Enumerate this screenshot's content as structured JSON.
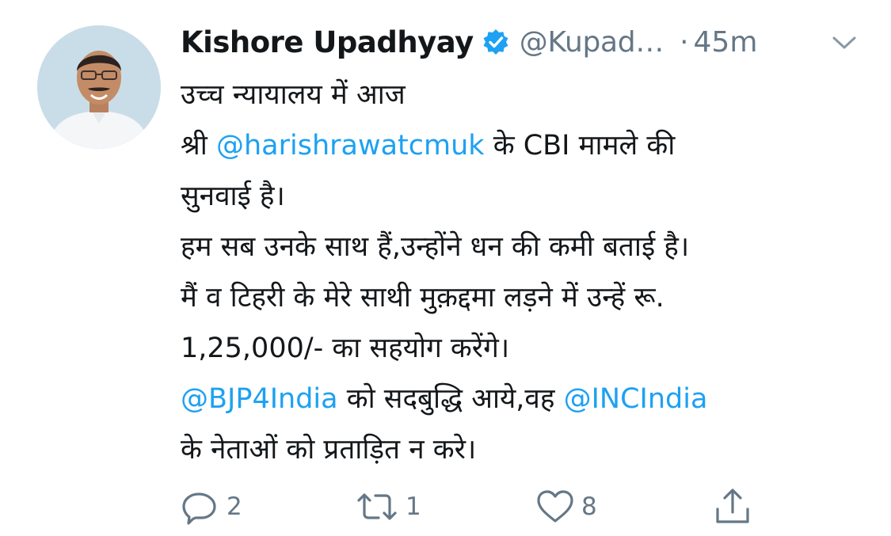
{
  "tweet": {
    "author": {
      "name": "Kishore Upadhyay",
      "handle": "@Kupad…",
      "verified": true,
      "avatar": "person-avatar"
    },
    "separator": "·",
    "time": "45m",
    "menu_icon": "chevron-down-icon",
    "lines": [
      [
        {
          "text": "उच्च न्यायालय में आज",
          "mention": false
        }
      ],
      [
        {
          "text": "श्री ",
          "mention": false
        },
        {
          "text": "@harishrawatcmuk",
          "mention": true
        },
        {
          "text": " के CBI मामले की",
          "mention": false
        }
      ],
      [
        {
          "text": "सुनवाई है।",
          "mention": false
        }
      ],
      [
        {
          "text": "हम सब उनके साथ हैं,उन्होंने धन की कमी बताई है।",
          "mention": false
        }
      ],
      [
        {
          "text": "मैं व टिहरी के मेरे साथी मुक़द्दमा लड़ने में उन्हें रू.",
          "mention": false
        }
      ],
      [
        {
          "text": "1,25,000/- का सहयोग करेंगे।",
          "mention": false
        }
      ],
      [
        {
          "text": "@BJP4India",
          "mention": true
        },
        {
          "text": " को सदबुद्धि आये,वह ",
          "mention": false
        },
        {
          "text": "@INCIndia",
          "mention": true
        }
      ],
      [
        {
          "text": "के नेताओं को प्रताड़ित न करे।",
          "mention": false
        }
      ]
    ],
    "actions": {
      "reply": {
        "icon": "reply-icon",
        "count": "2"
      },
      "retweet": {
        "icon": "retweet-icon",
        "count": "1"
      },
      "like": {
        "icon": "heart-icon",
        "count": "8"
      },
      "share": {
        "icon": "share-icon",
        "count": ""
      }
    }
  },
  "colors": {
    "text": "#14171a",
    "secondary": "#657786",
    "link": "#1da1f2",
    "verified_badge": "#1da1f2"
  }
}
